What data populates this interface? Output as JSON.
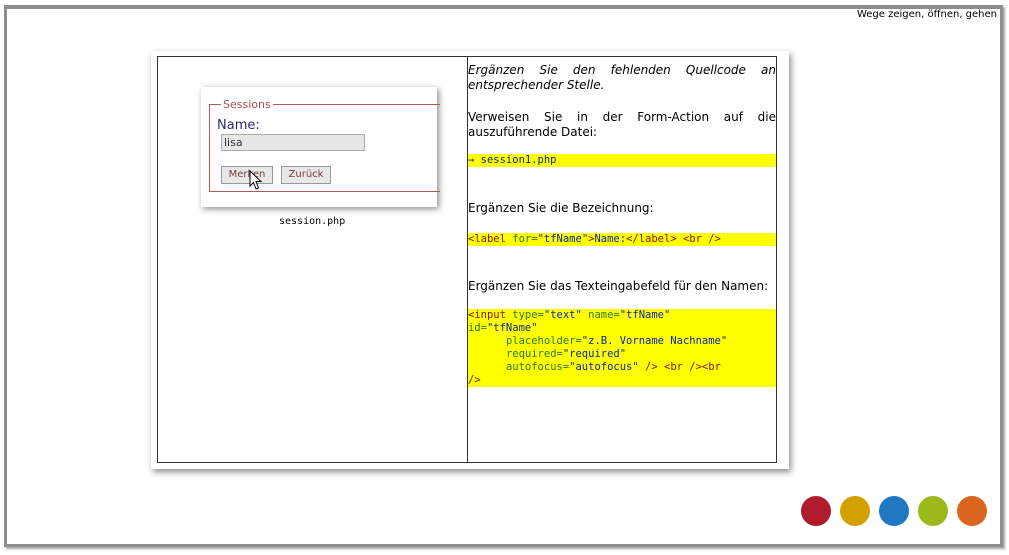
{
  "nav": {
    "label": "Wege zeigen, öffnen, gehen"
  },
  "mini_form": {
    "legend": "Sessions",
    "name_label": "Name:",
    "name_value": "lisa",
    "btn_merken": "Merken",
    "btn_zurueck": "Zurück",
    "filename": "session.php"
  },
  "right": {
    "intro": "Ergänzen Sie den fehlenden Quellcode an entsprechender Stelle.",
    "q1": "Verweisen Sie in der Form-Action auf die auszuführende Datei:",
    "a1": "→ session1.php",
    "q2": "Ergänzen Sie die Bezeichnung:",
    "q3": "Ergänzen Sie das Texteingabefeld für den Namen:"
  },
  "dots": {
    "colors": [
      "#b01c2e",
      "#d4a000",
      "#1f78c1",
      "#9cb91a",
      "#d9661c"
    ]
  }
}
